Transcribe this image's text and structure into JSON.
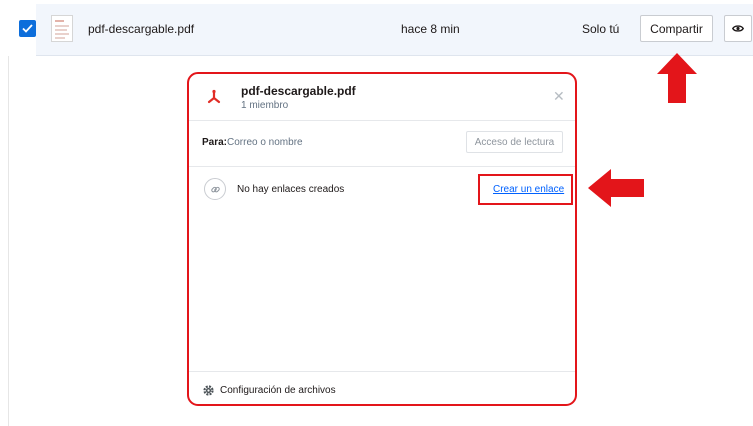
{
  "file_row": {
    "file_name": "pdf-descargable.pdf",
    "modified": "hace 8 min",
    "access": "Solo tú",
    "share_label": "Compartir",
    "icons": {
      "checkbox": "checkmark-icon",
      "thumbnail": "document-thumbnail-icon",
      "preview": "eye-icon"
    }
  },
  "share_modal": {
    "title": "pdf-descargable.pdf",
    "subtitle": "1 miembro",
    "to_label": "Para:",
    "to_placeholder": "Correo o nombre",
    "read_access_label": "Acceso de lectura",
    "no_links_text": "No hay enlaces creados",
    "create_link_label": "Crear un enlace",
    "settings_label": "Configuración de archivos",
    "icons": {
      "file": "pdf-icon",
      "close": "close-icon",
      "link": "link-icon",
      "settings": "gear-icon"
    }
  },
  "colors": {
    "accent": "#0d6edb",
    "link": "#0061fe",
    "annotation_red": "#e3151a",
    "pdf_red": "#e12d26",
    "row_highlight": "#f2f6fc"
  },
  "annotations": {
    "arrow_up": "red-arrow-up",
    "arrow_left": "red-arrow-left"
  }
}
